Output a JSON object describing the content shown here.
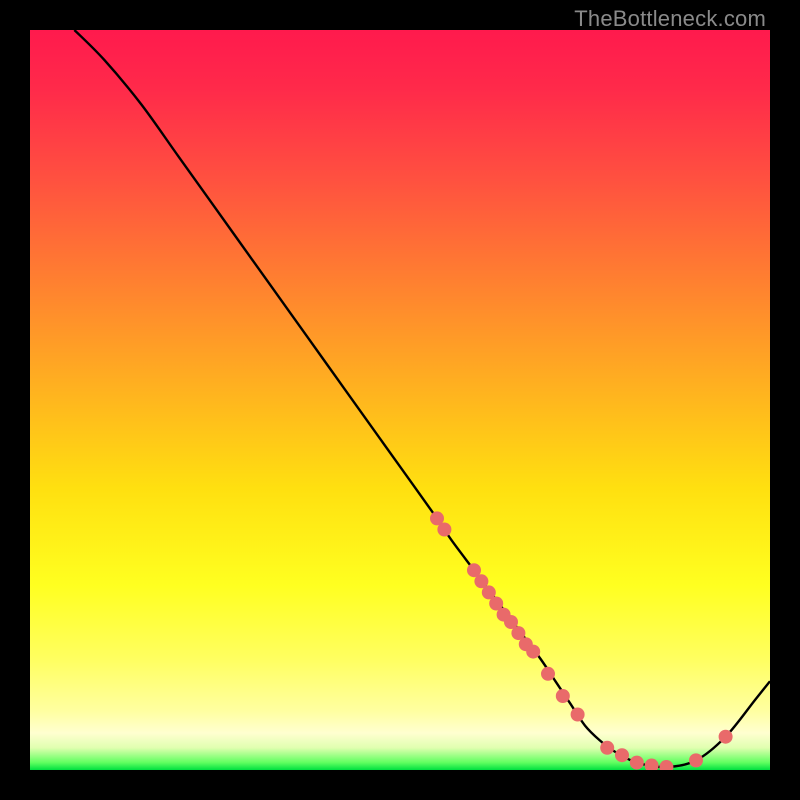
{
  "watermark": "TheBottleneck.com",
  "colors": {
    "curve_stroke": "#000000",
    "dot_fill": "#e96a6a",
    "dot_stroke": "#d24f4f"
  },
  "chart_data": {
    "type": "line",
    "title": "",
    "xlabel": "",
    "ylabel": "",
    "xlim": [
      0,
      100
    ],
    "ylim": [
      0,
      100
    ],
    "series": [
      {
        "name": "bottleneck-curve",
        "x": [
          6,
          10,
          15,
          20,
          25,
          30,
          35,
          40,
          45,
          50,
          55,
          57,
          60,
          63,
          66,
          69,
          71,
          73,
          75,
          77,
          79,
          82,
          86,
          90,
          94,
          98,
          100
        ],
        "y": [
          100,
          96,
          90,
          83,
          76,
          69,
          62,
          55,
          48,
          41,
          34,
          31,
          27,
          23,
          19,
          15,
          12,
          9,
          6,
          4,
          2.5,
          1,
          0.4,
          1.3,
          4.5,
          9.5,
          12
        ]
      }
    ],
    "scatter_points": {
      "name": "highlighted-points",
      "x": [
        55,
        56,
        60,
        61,
        62,
        63,
        64,
        65,
        66,
        67,
        68,
        70,
        72,
        74,
        78,
        80,
        82,
        84,
        86,
        90,
        94
      ],
      "y": [
        34,
        32.5,
        27,
        25.5,
        24,
        22.5,
        21,
        20,
        18.5,
        17,
        16,
        13,
        10,
        7.5,
        3,
        2,
        1,
        0.6,
        0.4,
        1.3,
        4.5
      ]
    }
  }
}
